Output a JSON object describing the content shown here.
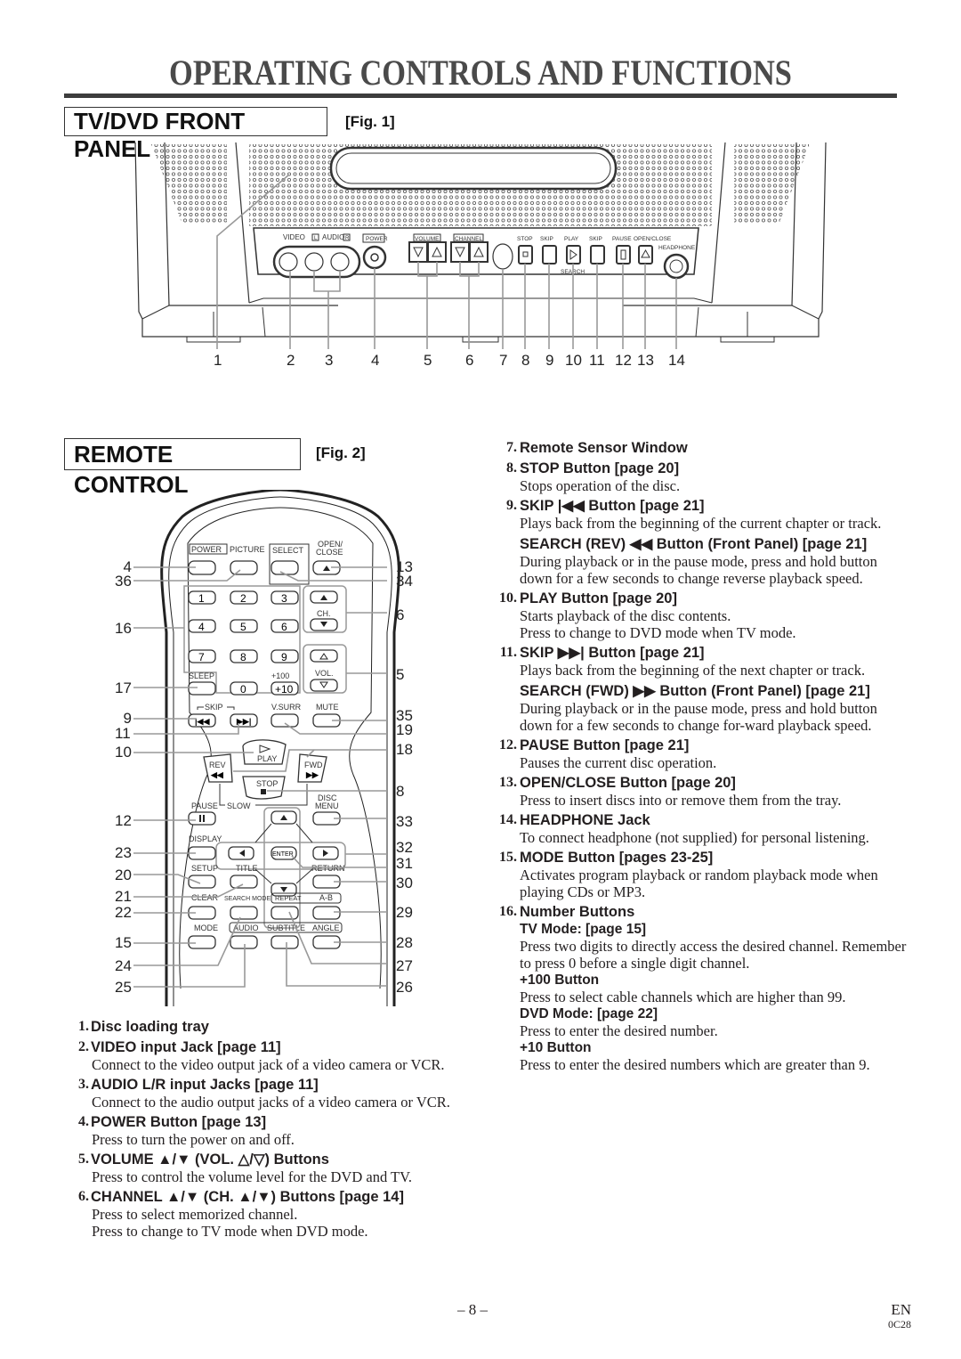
{
  "page": {
    "title": "OPERATING CONTROLS AND FUNCTIONS",
    "page_number": "– 8 –",
    "language": "EN",
    "code": "0C28"
  },
  "front_panel": {
    "section_title": "TV/DVD FRONT PANEL",
    "fig_label": "[Fig. 1]",
    "labels": {
      "video": "VIDEO",
      "audio": "AUDIO",
      "audio_l": "L",
      "audio_r": "R",
      "power": "POWER",
      "volume": "VOLUME",
      "channel": "CHANNEL",
      "stop": "STOP",
      "skip_back": "SKIP",
      "play": "PLAY",
      "skip_fwd": "SKIP",
      "pause": "PAUSE",
      "open_close": "OPEN/CLOSE",
      "headphone": "HEADPHONE",
      "search": "SEARCH"
    },
    "callouts": [
      "1",
      "2",
      "3",
      "4",
      "5",
      "6",
      "7",
      "8",
      "9",
      "10",
      "11",
      "12",
      "13",
      "14"
    ]
  },
  "remote": {
    "section_title": "REMOTE CONTROL",
    "fig_label": "[Fig. 2]",
    "labels": {
      "power": "POWER",
      "picture": "PICTURE",
      "select": "SELECT",
      "open": "OPEN/",
      "close": "CLOSE",
      "ch": "CH.",
      "vol": "VOL.",
      "sleep": "SLEEP",
      "plus100": "+100",
      "plus10": "+10",
      "skip": "SKIP",
      "vsurr": "V.SURR",
      "mute": "MUTE",
      "play": "PLAY",
      "rev": "REV",
      "fwd": "FWD",
      "stop": "STOP",
      "pause": "PAUSE",
      "slow": "SLOW",
      "disc": "DISC",
      "menu": "MENU",
      "display": "DISPLAY",
      "enter": "ENTER",
      "setup": "SETUP",
      "title": "TITLE",
      "return": "RETURN",
      "clear": "CLEAR",
      "search_mode": "SEARCH MODE",
      "repeat": "REPEAT",
      "ab": "A-B",
      "mode": "MODE",
      "audio": "AUDIO",
      "subtitle": "SUBTITLE",
      "angle": "ANGLE"
    },
    "digits": [
      "1",
      "2",
      "3",
      "4",
      "5",
      "6",
      "7",
      "8",
      "9",
      "0"
    ],
    "callouts_left": [
      "4",
      "36",
      "16",
      "17",
      "9",
      "11",
      "10",
      "12",
      "23",
      "20",
      "21",
      "22",
      "15",
      "24",
      "25"
    ],
    "callouts_right": [
      "13",
      "34",
      "6",
      "5",
      "35",
      "19",
      "18",
      "8",
      "33",
      "32",
      "31",
      "30",
      "29",
      "28",
      "27",
      "26"
    ]
  },
  "items_left": [
    {
      "num": "1.",
      "title": "Disc loading tray",
      "desc": []
    },
    {
      "num": "2.",
      "title": "VIDEO input Jack [page 11]",
      "desc": [
        "Connect to the video output jack of a video camera or VCR."
      ]
    },
    {
      "num": "3.",
      "title": "AUDIO L/R input Jacks [page 11]",
      "desc": [
        "Connect to the audio output jacks of a video camera or VCR."
      ]
    },
    {
      "num": "4.",
      "title": "POWER Button [page 13]",
      "desc": [
        "Press to turn the power on and off."
      ]
    },
    {
      "num": "5.",
      "title": "VOLUME ▲/▼ (VOL. △/▽) Buttons",
      "desc": [
        "Press to control the volume level for the DVD and TV."
      ]
    },
    {
      "num": "6.",
      "title": "CHANNEL ▲/▼ (CH. ▲/▼) Buttons [page 14]",
      "desc": [
        "Press to select memorized channel.",
        "Press to change to TV mode when DVD mode."
      ]
    }
  ],
  "items_right": [
    {
      "num": "7.",
      "title": "Remote Sensor Window"
    },
    {
      "num": "8.",
      "title": "STOP Button [page 20]",
      "desc": "Stops operation of the disc."
    },
    {
      "num": "9.",
      "title": "SKIP |◀◀ Button [page 21]",
      "desc": "Plays back from the beginning of the current chapter or track.",
      "sub": "SEARCH (REV) ◀◀ Button (Front Panel) [page 21]",
      "sub_desc": "During playback or in the pause mode, press and hold button down for a few seconds to change reverse playback speed."
    },
    {
      "num": "10.",
      "title": "PLAY Button [page 20]",
      "desc": "Starts playback of the disc contents.",
      "desc2": "Press to change to DVD mode when TV mode."
    },
    {
      "num": "11.",
      "title": "SKIP ▶▶| Button [page 21]",
      "desc": "Plays back from the beginning of the next chapter or track.",
      "sub": "SEARCH (FWD) ▶▶ Button (Front Panel) [page 21]",
      "sub_desc": "During playback or in the pause mode, press and hold button down for a few seconds to change for-ward playback speed."
    },
    {
      "num": "12.",
      "title": "PAUSE Button [page 21]",
      "desc": "Pauses the current disc operation."
    },
    {
      "num": "13.",
      "title": "OPEN/CLOSE Button [page 20]",
      "desc": "Press to insert discs into or remove them from the tray."
    },
    {
      "num": "14.",
      "title": "HEADPHONE Jack",
      "desc": "To connect headphone (not supplied) for personal listening."
    },
    {
      "num": "15.",
      "title": "MODE Button [pages 23-25]",
      "desc": "Activates program playback or random playback mode when playing CDs or MP3."
    },
    {
      "num": "16.",
      "title": "Number Buttons",
      "tv_mode": "TV Mode: [page 15]",
      "tv_desc": "Press two digits to directly access the desired channel. Remember to press 0 before a single digit channel.",
      "plus100": "+100 Button",
      "plus100_desc": "Press to select cable channels which are higher than 99.",
      "dvd_mode": "DVD Mode: [page 22]",
      "dvd_desc": "Press to enter the desired number.",
      "plus10": "+10 Button",
      "plus10_desc": "Press to enter the desired numbers which are greater than 9."
    }
  ]
}
